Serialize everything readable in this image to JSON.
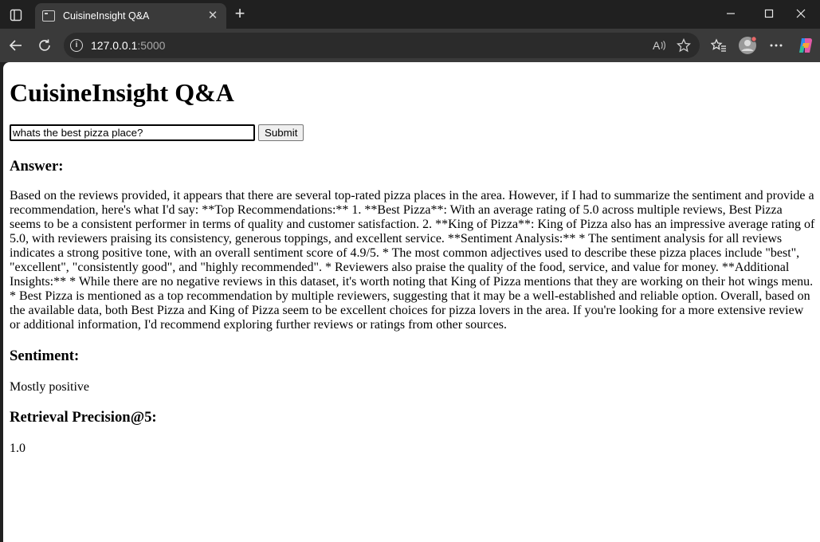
{
  "browser": {
    "tab_title": "CuisineInsight Q&A",
    "url_host": "127.0.0.1",
    "url_port": ":5000"
  },
  "page": {
    "title": "CuisineInsight Q&A",
    "search": {
      "value": "whats the best pizza place?",
      "submit_label": "Submit"
    },
    "answer_heading": "Answer:",
    "answer_text": "Based on the reviews provided, it appears that there are several top-rated pizza places in the area. However, if I had to summarize the sentiment and provide a recommendation, here's what I'd say: **Top Recommendations:** 1. **Best Pizza**: With an average rating of 5.0 across multiple reviews, Best Pizza seems to be a consistent performer in terms of quality and customer satisfaction. 2. **King of Pizza**: King of Pizza also has an impressive average rating of 5.0, with reviewers praising its consistency, generous toppings, and excellent service. **Sentiment Analysis:** * The sentiment analysis for all reviews indicates a strong positive tone, with an overall sentiment score of 4.9/5. * The most common adjectives used to describe these pizza places include \"best\", \"excellent\", \"consistently good\", and \"highly recommended\". * Reviewers also praise the quality of the food, service, and value for money. **Additional Insights:** * While there are no negative reviews in this dataset, it's worth noting that King of Pizza mentions that they are working on their hot wings menu. * Best Pizza is mentioned as a top recommendation by multiple reviewers, suggesting that it may be a well-established and reliable option. Overall, based on the available data, both Best Pizza and King of Pizza seem to be excellent choices for pizza lovers in the area. If you're looking for a more extensive review or additional information, I'd recommend exploring further reviews or ratings from other sources.",
    "sentiment_heading": "Sentiment:",
    "sentiment_value": "Mostly positive",
    "precision_heading": "Retrieval Precision@5:",
    "precision_value": "1.0"
  },
  "icons": {
    "tab_actions": "tab-actions-icon",
    "close_tab": "close-icon",
    "new_tab": "plus-icon",
    "minimize": "minimize-icon",
    "maximize": "maximize-icon",
    "close_window": "close-icon",
    "back": "back-arrow-icon",
    "refresh": "refresh-icon",
    "site_info": "info-icon",
    "read_aloud": "read-aloud-icon",
    "favorite": "star-icon",
    "favorites": "favorites-icon",
    "profile": "avatar-icon",
    "menu": "more-icon",
    "copilot": "copilot-icon"
  }
}
